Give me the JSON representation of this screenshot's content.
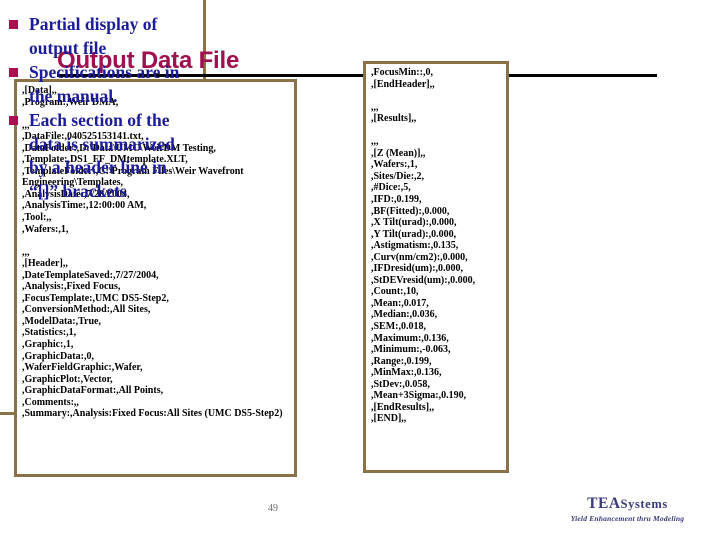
{
  "slide": {
    "title": "Output Data File",
    "page_number": "49",
    "accent_colors": {
      "title": "#A01050",
      "box_border": "#8A7148",
      "bullet_text": "#1B1B9B",
      "bullet_square": "#A81050",
      "logo": "#3A3A7C",
      "rule": "#000000"
    }
  },
  "left_panel": {
    "lines": [
      ",[Data],,",
      ",Program:,Weir DMA,",
      "",
      ",,,",
      ",DataFile:,040525153141.txt,",
      ",DataFolder:,D:\\Data\\UMC\\WeirDM Testing,",
      ",Template:,DS1_FF_DMtemplate.XLT,",
      ",TemplateFolder:,C:\\Program Files\\Weir Wavefront Engineering\\Templates,",
      ",AnalysisDate:,7/28/2004,",
      ",AnalysisTime:,12:00:00 AM,",
      ",Tool:,,",
      ",Wafers:,1,",
      "",
      ",,,",
      ",[Header],,",
      ",DateTemplateSaved:,7/27/2004,",
      ",Analysis:,Fixed Focus,",
      ",FocusTemplate:,UMC DS5-Step2,",
      ",ConversionMethod:,All Sites,",
      ",ModelData:,True,",
      ",Statistics:,1,",
      ",Graphic:,1,",
      ",GraphicData:,0,",
      ",WaferFieldGraphic:,Wafer,",
      ",GraphicPlot:,Vector,",
      ",GraphicDataFormat:,All Points,",
      ",Comments:,,",
      ",Summary:,Analysis:Fixed Focus:All Sites (UMC DS5-Step2)"
    ]
  },
  "middle_panel": {
    "lines": [
      ",FocusMin::,0,",
      ",[EndHeader],,",
      "",
      ",,,",
      ",[Results],,",
      "",
      ",,,",
      ",[Z (Mean)],,",
      ",Wafers:,1,",
      ",Sites/Die:,2,",
      ",#Dice:,5,",
      ",IFD:,0.199,",
      ",BF(Fitted):,0.000,",
      ",X Tilt(urad):,0.000,",
      ",Y Tilt(urad):,0.000,",
      ",Astigmatism:,0.135,",
      ",Curv(nm/cm2):,0.000,",
      ",IFDresid(um):,0.000,",
      ",StDEVresid(um):,0.000,",
      ",Count:,10,",
      ",Mean:,0.017,",
      ",Median:,0.036,",
      ",SEM:,0.018,",
      ",Maximum:,0.136,",
      ",Minimum:,-0.063,",
      ",Range:,0.199,",
      ",MinMax:,0.136,",
      ",StDev:,0.058,",
      ",Mean+3Sigma:,0.190,",
      ",[EndResults],,",
      ",[END],,"
    ]
  },
  "right_panel": {
    "bullets": [
      "Partial display of output file",
      "Specifications are in the manual.",
      "Each section of the data is summarized by a header line in “[]” brackets"
    ]
  },
  "footer": {
    "logo_name": "TEA",
    "logo_suffix": "Systems",
    "logo_tagline": "Yield Enhancement thru Modeling"
  }
}
